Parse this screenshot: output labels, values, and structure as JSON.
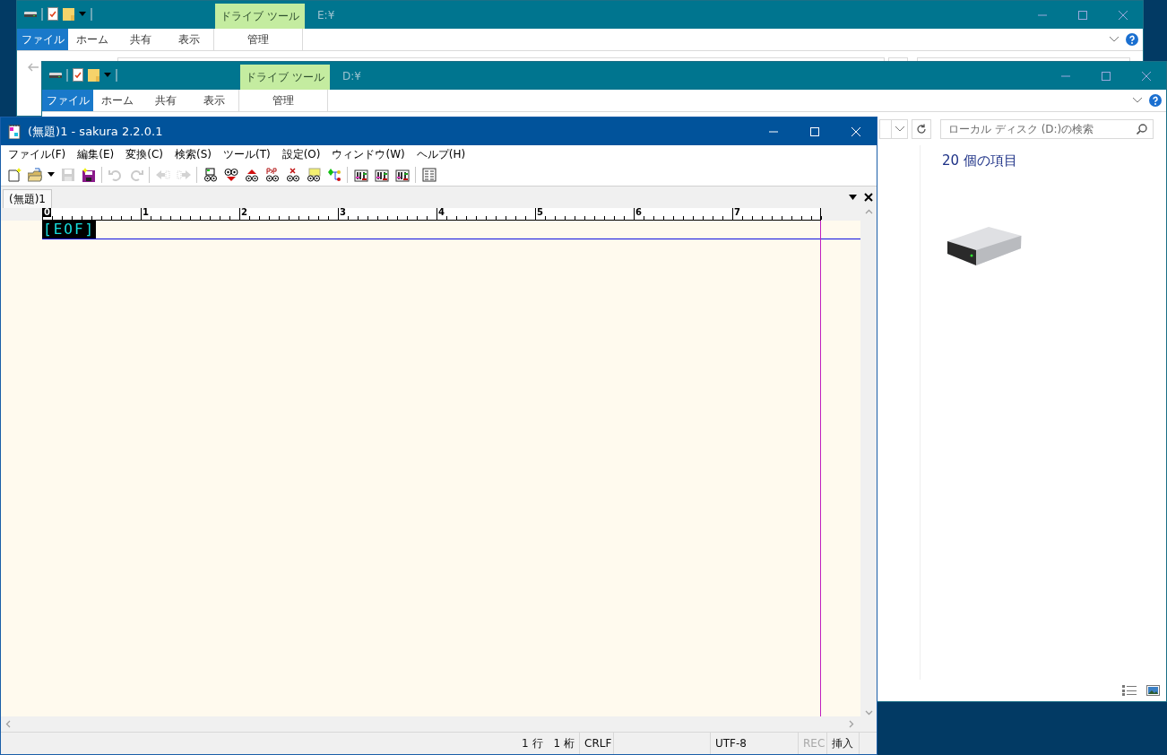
{
  "explorer_windows": [
    {
      "title": "E:¥",
      "context_header": "ドライブ ツール",
      "ribbon_tabs": [
        {
          "label": "ファイル",
          "kind": "file"
        },
        {
          "label": "ホーム",
          "kind": "tab"
        },
        {
          "label": "共有",
          "kind": "tab"
        },
        {
          "label": "表示",
          "kind": "tab"
        },
        {
          "label": "管理",
          "kind": "context"
        }
      ]
    },
    {
      "title": "D:¥",
      "context_header": "ドライブ ツール",
      "ribbon_tabs": [
        {
          "label": "ファイル",
          "kind": "file"
        },
        {
          "label": "ホーム",
          "kind": "tab"
        },
        {
          "label": "共有",
          "kind": "tab"
        },
        {
          "label": "表示",
          "kind": "tab"
        },
        {
          "label": "管理",
          "kind": "context"
        }
      ],
      "search": {
        "placeholder": "ローカル ディスク (D:)の検索"
      },
      "item_count": "20 個の項目"
    }
  ],
  "editor": {
    "title": "(無題)1 - sakura 2.2.0.1",
    "menu": [
      "ファイル(F)",
      "編集(E)",
      "変換(C)",
      "検索(S)",
      "ツール(T)",
      "設定(O)",
      "ウィンドウ(W)",
      "ヘルプ(H)"
    ],
    "toolbar": [
      {
        "kind": "new",
        "disabled": false
      },
      {
        "kind": "open",
        "disabled": false
      },
      {
        "kind": "dropdown",
        "disabled": false
      },
      {
        "kind": "save",
        "disabled": true
      },
      {
        "kind": "save-all",
        "disabled": false
      },
      {
        "kind": "separator",
        "disabled": false
      },
      {
        "kind": "undo",
        "disabled": true
      },
      {
        "kind": "redo",
        "disabled": true
      },
      {
        "kind": "separator",
        "disabled": false
      },
      {
        "kind": "back",
        "disabled": true
      },
      {
        "kind": "forward",
        "disabled": true
      },
      {
        "kind": "separator",
        "disabled": false
      },
      {
        "kind": "find",
        "disabled": false
      },
      {
        "kind": "find-down",
        "disabled": false
      },
      {
        "kind": "find-up",
        "disabled": false
      },
      {
        "kind": "replace",
        "disabled": false
      },
      {
        "kind": "clear",
        "disabled": false
      },
      {
        "kind": "grep",
        "disabled": false
      },
      {
        "kind": "outline",
        "disabled": false
      },
      {
        "kind": "separator",
        "disabled": false
      },
      {
        "kind": "settings",
        "disabled": false
      },
      {
        "kind": "settings",
        "disabled": false
      },
      {
        "kind": "settings",
        "disabled": false
      },
      {
        "kind": "separator",
        "disabled": false
      },
      {
        "kind": "list",
        "disabled": false
      }
    ],
    "tabs": [
      {
        "label": "(無題)1",
        "selected": true
      }
    ],
    "ruler": [
      {
        "label": "0",
        "current": true
      },
      {
        "label": "1",
        "current": false
      },
      {
        "label": "2",
        "current": false
      },
      {
        "label": "3",
        "current": false
      },
      {
        "label": "4",
        "current": false
      },
      {
        "label": "5",
        "current": false
      },
      {
        "label": "6",
        "current": false
      },
      {
        "label": "7",
        "current": false
      }
    ],
    "eof": "[EOF]",
    "status": {
      "position": "1 行　1 桁",
      "line_ending": "CRLF",
      "encoding": "UTF-8",
      "rec": {
        "label": "REC",
        "disabled": true
      },
      "mode": "挿入"
    }
  }
}
